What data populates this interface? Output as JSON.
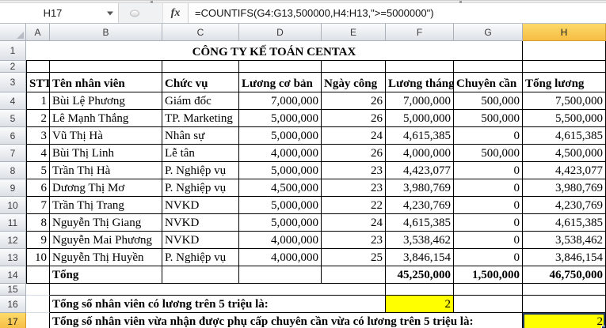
{
  "app": {
    "name_box": "H17",
    "fx_label": "fx",
    "formula": "=COUNTIFS(G4:G13,500000,H4:H13,\">=5000000\")"
  },
  "grid": {
    "column_headers": [
      "A",
      "B",
      "C",
      "D",
      "E",
      "F",
      "G",
      "H"
    ],
    "row_headers": [
      "1",
      "2",
      "3",
      "4",
      "5",
      "6",
      "7",
      "8",
      "9",
      "10",
      "11",
      "12",
      "13",
      "14",
      "15",
      "16",
      "17"
    ],
    "selected_cell": "H17",
    "selected_column": "H",
    "selected_row": "17"
  },
  "colors": {
    "title_red": "#FF0000",
    "cell_highlight_yellow": "#FFFF00",
    "selected_header_gold": "#F8C64B",
    "selection_border_navy": "#1F3864"
  },
  "sheet": {
    "title": "CÔNG TY KẾ TOÁN CENTAX",
    "headers": {
      "stt": "STT",
      "name": "Tên nhân viên",
      "position": "Chức vụ",
      "base_salary": "Lương cơ bản",
      "work_days": "Ngày công",
      "month_salary": "Lương tháng",
      "bonus": "Chuyên cần",
      "total": "Tổng lương"
    },
    "employees": [
      {
        "stt": "1",
        "name": "Bùi Lệ Phương",
        "position": "Giám đốc",
        "base_salary": "7,000,000",
        "work_days": "26",
        "month_salary": "7,000,000",
        "bonus": "500,000",
        "total": "7,500,000"
      },
      {
        "stt": "2",
        "name": "Lê Mạnh Thắng",
        "position": "TP. Marketing",
        "base_salary": "5,000,000",
        "work_days": "26",
        "month_salary": "5,000,000",
        "bonus": "500,000",
        "total": "5,500,000"
      },
      {
        "stt": "3",
        "name": "Vũ Thị Hà",
        "position": "Nhân sự",
        "base_salary": "5,000,000",
        "work_days": "24",
        "month_salary": "4,615,385",
        "bonus": "0",
        "total": "4,615,385"
      },
      {
        "stt": "4",
        "name": "Bùi Thị Linh",
        "position": "Lễ tân",
        "base_salary": "4,000,000",
        "work_days": "26",
        "month_salary": "4,000,000",
        "bonus": "500,000",
        "total": "4,500,000"
      },
      {
        "stt": "5",
        "name": "Trần Thị Hà",
        "position": "P. Nghiệp vụ",
        "base_salary": "5,000,000",
        "work_days": "23",
        "month_salary": "4,423,077",
        "bonus": "0",
        "total": "4,423,077"
      },
      {
        "stt": "6",
        "name": "Dương Thị Mơ",
        "position": "P. Nghiệp vụ",
        "base_salary": "4,500,000",
        "work_days": "23",
        "month_salary": "3,980,769",
        "bonus": "0",
        "total": "3,980,769"
      },
      {
        "stt": "7",
        "name": "Trần Thị Trang",
        "position": "NVKD",
        "base_salary": "5,000,000",
        "work_days": "22",
        "month_salary": "4,230,769",
        "bonus": "0",
        "total": "4,230,769"
      },
      {
        "stt": "8",
        "name": "Nguyễn Thị Giang",
        "position": "NVKD",
        "base_salary": "5,000,000",
        "work_days": "24",
        "month_salary": "4,615,385",
        "bonus": "0",
        "total": "4,615,385"
      },
      {
        "stt": "9",
        "name": "Nguyễn Mai Phương",
        "position": "NVKD",
        "base_salary": "4,000,000",
        "work_days": "23",
        "month_salary": "3,538,462",
        "bonus": "0",
        "total": "3,538,462"
      },
      {
        "stt": "10",
        "name": "Nguyễn Thị Huyền",
        "position": "P. Nghiệp vụ",
        "base_salary": "4,000,000",
        "work_days": "25",
        "month_salary": "3,846,154",
        "bonus": "0",
        "total": "3,846,154"
      }
    ],
    "totals": {
      "label": "Tổng",
      "month_salary": "45,250,000",
      "bonus": "1,500,000",
      "total": "46,750,000"
    },
    "summary_high_salary": {
      "label": "Tổng số nhân viên có lương trên 5 triệu là:",
      "value": "2"
    },
    "summary_bonus_and_high_salary": {
      "label": "Tổng số nhân viên vừa nhận được phụ cấp chuyên cần vừa có lương trên 5 triệu là:",
      "value": "2"
    }
  }
}
